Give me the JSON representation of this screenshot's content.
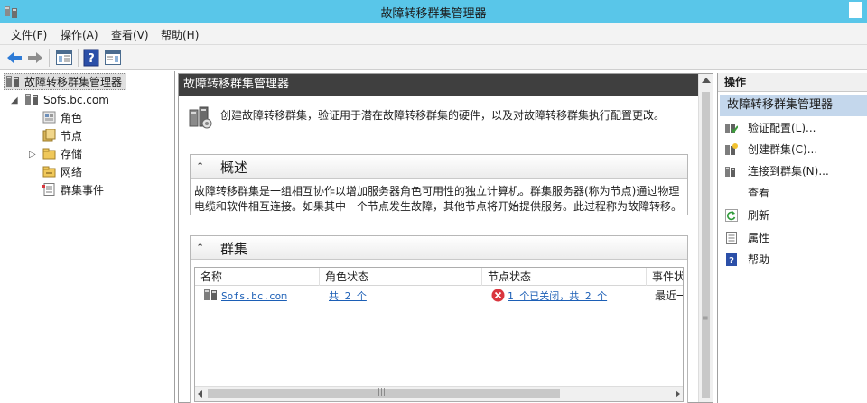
{
  "window": {
    "title": "故障转移群集管理器"
  },
  "menu": {
    "items": [
      "文件(F)",
      "操作(A)",
      "查看(V)",
      "帮助(H)"
    ]
  },
  "tree": {
    "root": "故障转移群集管理器",
    "cluster": "Sofs.bc.com",
    "children": [
      "角色",
      "节点",
      "存储",
      "网络",
      "群集事件"
    ]
  },
  "center": {
    "header": "故障转移群集管理器",
    "intro": "创建故障转移群集，验证用于潜在故障转移群集的硬件，以及对故障转移群集执行配置更改。",
    "overview": {
      "title": "概述",
      "line1": "故障转移群集是一组相互协作以增加服务器角色可用性的独立计算机。群集服务器(称为节点)通过物理",
      "line2": "电缆和软件相互连接。如果其中一个节点发生故障，其他节点将开始提供服务。此过程称为故障转移。"
    },
    "clusters": {
      "title": "群集",
      "columns": [
        "名称",
        "角色状态",
        "节点状态",
        "事件状"
      ],
      "rows": [
        {
          "name": "Sofs.bc.com",
          "roles": "共 2 个",
          "nodes": "1 个已关闭，共 2 个",
          "events": "最近一"
        }
      ]
    }
  },
  "actions": {
    "header": "操作",
    "subheader": "故障转移群集管理器",
    "items": [
      "验证配置(L)...",
      "创建群集(C)...",
      "连接到群集(N)...",
      "查看",
      "刷新",
      "属性",
      "帮助"
    ]
  },
  "colors": {
    "titlebar": "#59c6e9",
    "header_dark": "#3f3f3f",
    "selection": "#c4d7ec",
    "link": "#1c5fb6",
    "error": "#d9363e"
  }
}
